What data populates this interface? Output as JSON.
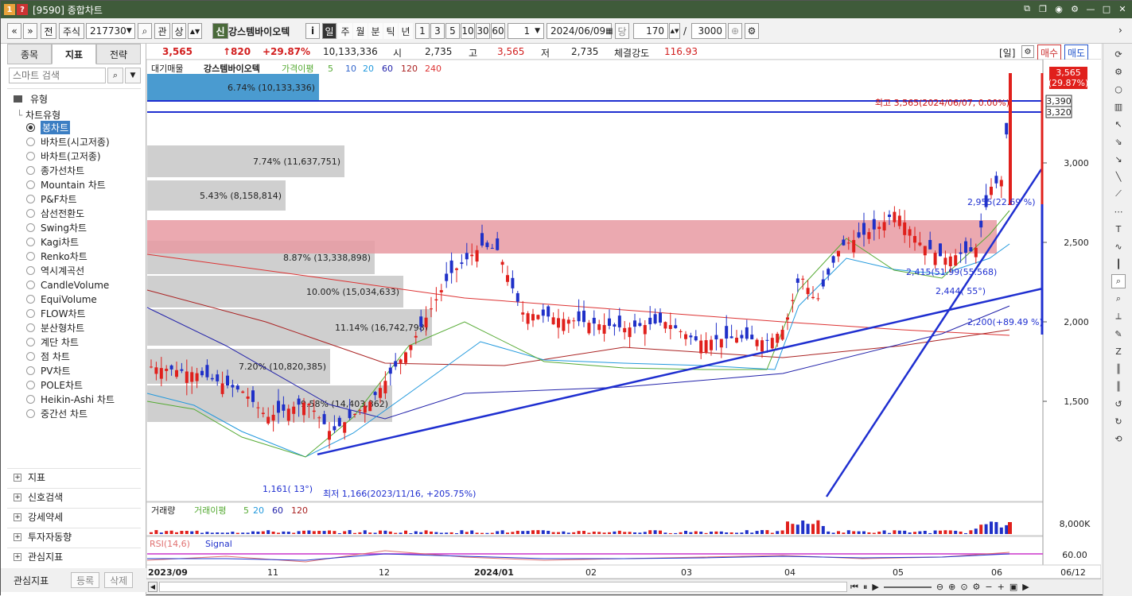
{
  "window": {
    "number": "1",
    "help": "?",
    "title": "[9590] 종합차트"
  },
  "toolbar": {
    "nav_prev": "«",
    "nav_down": "»",
    "jeon": "전",
    "asset_type": "주식",
    "code": "217730",
    "gwan": "관",
    "sang": "상",
    "sin": "신",
    "stock_name": "강스템바이오텍",
    "info": "i",
    "periods": [
      "일",
      "주",
      "월",
      "분",
      "틱",
      "년"
    ],
    "intervals": [
      "1",
      "3",
      "5",
      "10",
      "30",
      "60"
    ],
    "interval_value": "1",
    "date": "2024/06/09",
    "dang": "당",
    "count": "170",
    "slash": "/",
    "total": "3000"
  },
  "left": {
    "tabs": [
      "종목",
      "지표",
      "전략"
    ],
    "search_placeholder": "스마트 검색",
    "group_title": "유형",
    "subgroup": "차트유형",
    "chart_types": [
      "봉차트",
      "바차트(시고저종)",
      "바차트(고저종)",
      "종가선차트",
      "Mountain 차트",
      "P&F차트",
      "삼선전환도",
      "Swing차트",
      "Kagi차트",
      "Renko차트",
      "역시계곡선",
      "CandleVolume",
      "EquiVolume",
      "FLOW차트",
      "분산형차트",
      "계단 차트",
      "점 차트",
      "PV차트",
      "POLE차트",
      "Heikin-Ashi 차트",
      "중간선 차트"
    ],
    "groups": [
      "지표",
      "신호검색",
      "강세약세",
      "투자자동향",
      "관심지표"
    ],
    "bottom_label": "관심지표",
    "btn_register": "등록",
    "btn_delete": "삭제"
  },
  "quote": {
    "price": "3,565",
    "change": "↑820",
    "change_pct": "+29.87%",
    "volume": "10,133,336",
    "open_label": "시",
    "open": "2,735",
    "high_label": "고",
    "high": "3,565",
    "low_label": "저",
    "low": "2,735",
    "strength_label": "체결강도",
    "strength": "116.93",
    "period_tag": "[일]",
    "buy": "매수",
    "sell": "매도"
  },
  "legend": {
    "main": "대기매물",
    "name": "강스템바이오텍",
    "ma_label": "가격이평",
    "ma_periods": [
      "5",
      "10",
      "20",
      "60",
      "120",
      "240"
    ],
    "ma_colors": [
      "#55aa33",
      "#3366cc",
      "#2299dd",
      "#2222aa",
      "#aa2222",
      "#dd3333"
    ],
    "vol_label": "거래량",
    "vol_ma_label": "거래이평",
    "vol_ma_periods": [
      "5",
      "20",
      "60",
      "120"
    ],
    "rsi_label": "RSI(14,6)",
    "rsi_signal": "Signal"
  },
  "annotations": {
    "high_note": "최고 3,565(2024/06/07, 0.00%)",
    "low_note": "최저 1,166(2023/11/16, +205.75%)",
    "price_tag": "3,565",
    "price_tag_pct": "(29.87%)",
    "line1": "3,390",
    "line2": "3,320",
    "angle_low": "1,161( 13°)",
    "mid_note": "2,955(22.69 %)",
    "pink_note": "2,415(51.99(55.568)",
    "angle_mid": "2,444( 55°)",
    "support_note": "2,200(+89.49 %)"
  },
  "chart_data": {
    "type": "candlestick",
    "y_ticks": [
      "3,000",
      "2,500",
      "2,000",
      "1,500"
    ],
    "y_tick_values": [
      3000,
      2500,
      2000,
      1500
    ],
    "ylim": [
      870,
      3610
    ],
    "x_labels": [
      "2023/09",
      "11",
      "12",
      "2024/01",
      "02",
      "03",
      "04",
      "05",
      "06"
    ],
    "last_x_label": "06/12",
    "vol_tick": "8,000K",
    "rsi_tick": "60.00",
    "volume_profile": [
      {
        "pct": "6.74% (10,133,336)",
        "value": 10133336,
        "highlight": true
      },
      {
        "pct": "7.74% (11,637,751)",
        "value": 11637751
      },
      {
        "pct": "5.43% (8,158,814)",
        "value": 8158814
      },
      {
        "pct": "8.87% (13,338,898)",
        "value": 13338898
      },
      {
        "pct": "10.00% (15,034,633)",
        "value": 15034633
      },
      {
        "pct": "11.14% (16,742,798)",
        "value": 16742798
      },
      {
        "pct": "7.20% (10,820,385)",
        "value": 10820385
      },
      {
        "pct": "9.58% (14,403,862)",
        "value": 14403862
      }
    ]
  }
}
